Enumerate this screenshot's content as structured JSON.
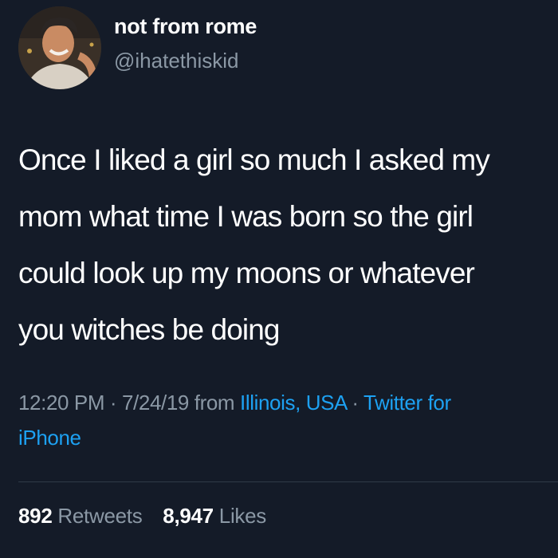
{
  "user": {
    "display_name": "not from rome",
    "handle": "@ihatethiskid"
  },
  "tweet": {
    "lines": [
      "Once I liked a girl so much I asked my",
      "mom what time I was born so the girl",
      "could look up my moons or whatever",
      "you witches be doing"
    ]
  },
  "meta": {
    "time": "12:20 PM",
    "sep1": " · ",
    "date": "7/24/19",
    "from": " from ",
    "location": "Illinois, USA",
    "sep2": " · ",
    "client_part1": "Twitter for",
    "client_part2": "iPhone"
  },
  "stats": {
    "retweets_count": "892",
    "retweets_label": "Retweets",
    "likes_count": "8,947",
    "likes_label": "Likes"
  },
  "colors": {
    "background": "#141b28",
    "link": "#1da1f2",
    "muted": "#8b98a5"
  }
}
